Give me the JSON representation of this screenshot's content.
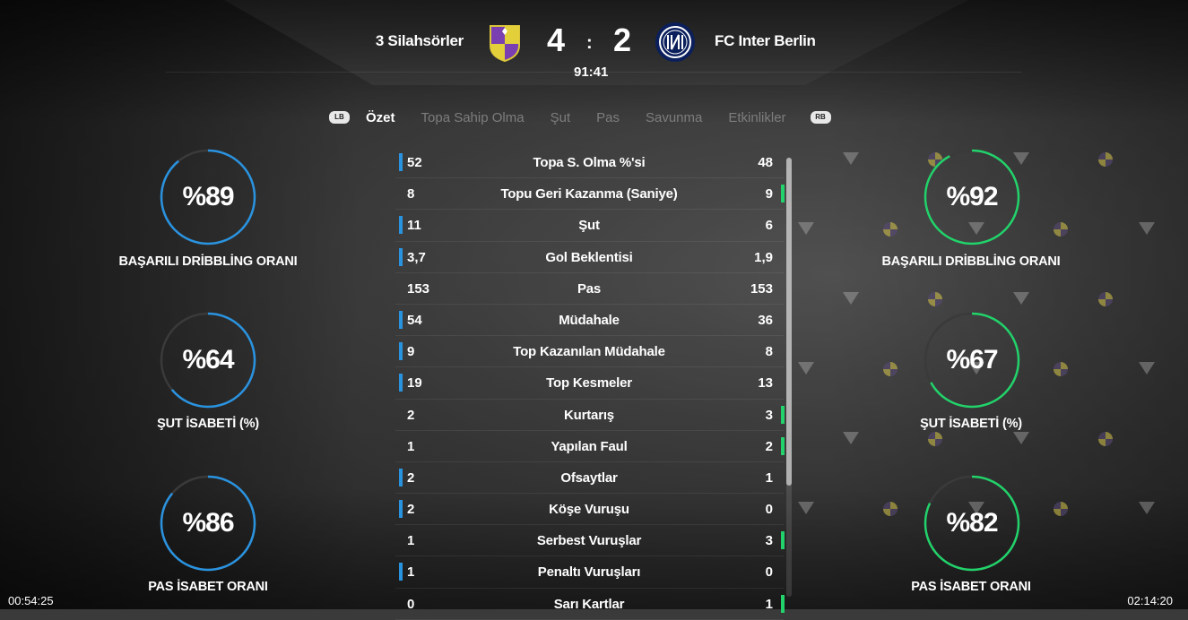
{
  "match": {
    "home_team": "3 Silahsörler",
    "away_team": "FC Inter Berlin",
    "home_score": "4",
    "away_score": "2",
    "separator": ":",
    "clock": "91:41"
  },
  "tabs": {
    "lb": "LB",
    "rb": "RB",
    "items": [
      "Özet",
      "Topa Sahip Olma",
      "Şut",
      "Pas",
      "Savunma",
      "Etkinlikler"
    ],
    "active": "Özet"
  },
  "home_gauges": [
    {
      "value_text": "%89",
      "value": 89,
      "label": "BAŞARILI DRİBBLİNG ORANI"
    },
    {
      "value_text": "%64",
      "value": 64,
      "label": "ŞUT İSABETİ (%)"
    },
    {
      "value_text": "%86",
      "value": 86,
      "label": "PAS İSABET ORANI"
    }
  ],
  "away_gauges": [
    {
      "value_text": "%92",
      "value": 92,
      "label": "BAŞARILI DRİBBLİNG ORANI"
    },
    {
      "value_text": "%67",
      "value": 67,
      "label": "ŞUT İSABETİ (%)"
    },
    {
      "value_text": "%82",
      "value": 82,
      "label": "PAS İSABET ORANI"
    }
  ],
  "stats": [
    {
      "home": "52",
      "label": "Topa S. Olma %'si",
      "away": "48",
      "leader": "home"
    },
    {
      "home": "8",
      "label": "Topu Geri Kazanma (Saniye)",
      "away": "9",
      "leader": "away"
    },
    {
      "home": "11",
      "label": "Şut",
      "away": "6",
      "leader": "home"
    },
    {
      "home": "3,7",
      "label": "Gol Beklentisi",
      "away": "1,9",
      "leader": "home"
    },
    {
      "home": "153",
      "label": "Pas",
      "away": "153",
      "leader": "none"
    },
    {
      "home": "54",
      "label": "Müdahale",
      "away": "36",
      "leader": "home"
    },
    {
      "home": "9",
      "label": "Top Kazanılan Müdahale",
      "away": "8",
      "leader": "home"
    },
    {
      "home": "19",
      "label": "Top Kesmeler",
      "away": "13",
      "leader": "home"
    },
    {
      "home": "2",
      "label": "Kurtarış",
      "away": "3",
      "leader": "away"
    },
    {
      "home": "1",
      "label": "Yapılan Faul",
      "away": "2",
      "leader": "away"
    },
    {
      "home": "2",
      "label": "Ofsaytlar",
      "away": "1",
      "leader": "home"
    },
    {
      "home": "2",
      "label": "Köşe Vuruşu",
      "away": "0",
      "leader": "home"
    },
    {
      "home": "1",
      "label": "Serbest Vuruşlar",
      "away": "3",
      "leader": "away"
    },
    {
      "home": "1",
      "label": "Penaltı Vuruşları",
      "away": "0",
      "leader": "home"
    },
    {
      "home": "0",
      "label": "Sarı Kartlar",
      "away": "1",
      "leader": "away"
    }
  ],
  "colors": {
    "home_accent": "#2a93e0",
    "away_accent": "#22d26a",
    "gauge_track": "#3a3a3a"
  },
  "footer": {
    "time_left": "00:54:25",
    "time_right": "02:14:20"
  }
}
